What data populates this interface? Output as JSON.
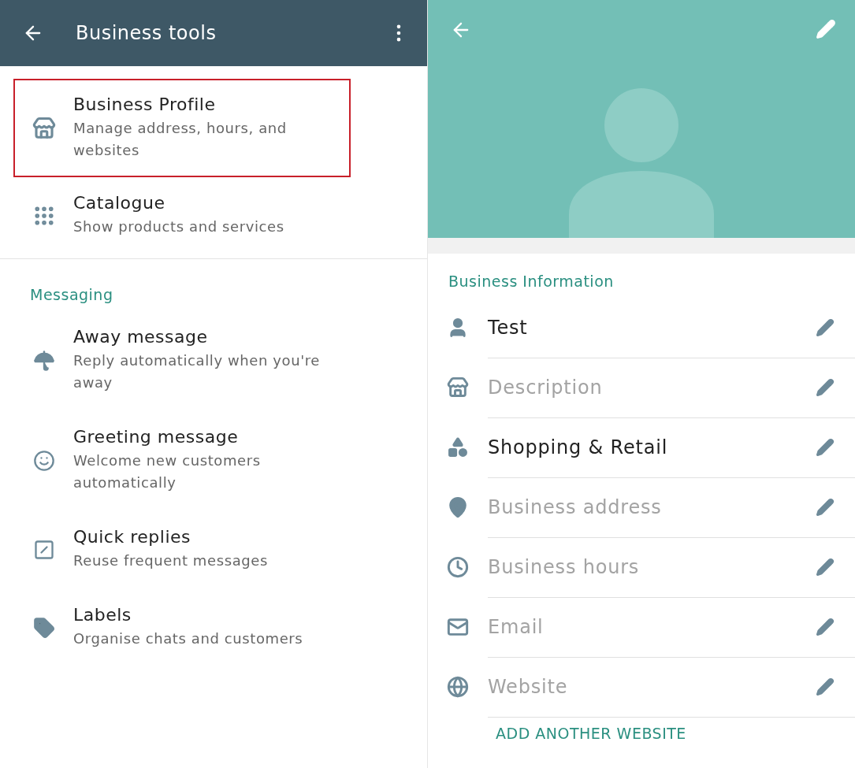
{
  "tools_screen": {
    "title": "Business tools",
    "items": [
      {
        "title": "Business Profile",
        "subtitle": "Manage address, hours, and websites",
        "highlighted": true
      },
      {
        "title": "Catalogue",
        "subtitle": "Show products and services",
        "highlighted": false
      }
    ],
    "section": "Messaging",
    "messaging_items": [
      {
        "title": "Away message",
        "subtitle": "Reply automatically when you're away"
      },
      {
        "title": "Greeting message",
        "subtitle": "Welcome new customers automatically"
      },
      {
        "title": "Quick replies",
        "subtitle": "Reuse frequent messages"
      },
      {
        "title": "Labels",
        "subtitle": "Organise chats and customers"
      }
    ]
  },
  "profile_screen": {
    "section": "Business Information",
    "fields": [
      {
        "value": "Test"
      },
      {
        "placeholder": "Description"
      },
      {
        "value": "Shopping & Retail"
      },
      {
        "placeholder": "Business address"
      },
      {
        "placeholder": "Business hours"
      },
      {
        "placeholder": "Email"
      },
      {
        "placeholder": "Website"
      }
    ],
    "link": "ADD ANOTHER WEBSITE"
  }
}
